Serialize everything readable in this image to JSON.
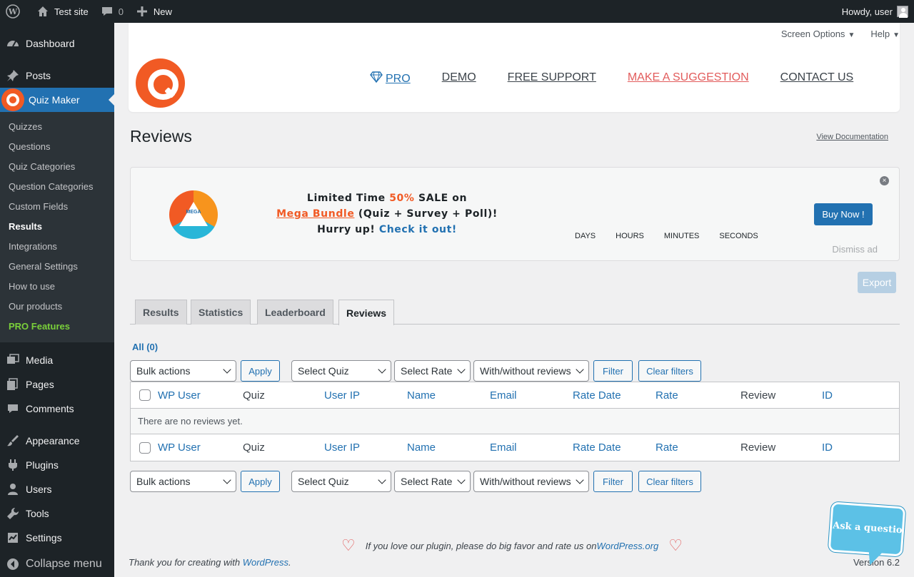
{
  "admin_bar": {
    "site_name": "Test site",
    "comments_count": "0",
    "new_label": "New",
    "greeting": "Howdy, user"
  },
  "sidebar": {
    "dashboard": "Dashboard",
    "posts": "Posts",
    "plugin": "Quiz Maker",
    "submenu": [
      "Quizzes",
      "Questions",
      "Quiz Categories",
      "Question Categories",
      "Custom Fields",
      "Results",
      "Integrations",
      "General Settings",
      "How to use",
      "Our products",
      "PRO Features"
    ],
    "bottom": [
      "Media",
      "Pages",
      "Comments",
      "Appearance",
      "Plugins",
      "Users",
      "Tools",
      "Settings"
    ],
    "collapse": "Collapse menu"
  },
  "screen_meta": {
    "options": "Screen Options",
    "help": "Help"
  },
  "plugin_nav": [
    "PRO",
    "DEMO",
    "FREE SUPPORT",
    "MAKE A SUGGESTION",
    "CONTACT US"
  ],
  "page": {
    "title": "Reviews",
    "view_doc": "View Documentation"
  },
  "promo": {
    "logo_text": "MEGA",
    "line1_a": "Limited Time ",
    "line1_sale": "50%",
    "line1_b": " SALE on",
    "bundle": "Mega Bundle",
    "line2_b": " (Quiz + Survey + Poll)!",
    "line3_a": "Hurry up! ",
    "check": "Check it out!",
    "countdown": [
      "DAYS",
      "HOURS",
      "MINUTES",
      "SECONDS"
    ],
    "buy": "Buy Now !",
    "dismiss": "Dismiss ad"
  },
  "export": "Export",
  "tabs": [
    "Results",
    "Statistics",
    "Leaderboard",
    "Reviews"
  ],
  "subsub": "All (0)",
  "filters": {
    "bulk": "Bulk actions",
    "apply": "Apply",
    "quiz": "Select Quiz",
    "rate": "Select Rate",
    "reviews": "With/without reviews",
    "filter": "Filter",
    "clear": "Clear filters"
  },
  "table": {
    "columns": [
      "WP User",
      "Quiz",
      "User IP",
      "Name",
      "Email",
      "Rate Date",
      "Rate",
      "Review",
      "ID"
    ],
    "empty": "There are no reviews yet."
  },
  "footer": {
    "love_a": "If you love our plugin, please do big favor and rate us on ",
    "love_link": "WordPress.org",
    "thanks_a": "Thank you for creating with ",
    "thanks_link": "WordPress",
    "thanks_b": ".",
    "version": "Version 6.2"
  },
  "ask": "Ask a question"
}
